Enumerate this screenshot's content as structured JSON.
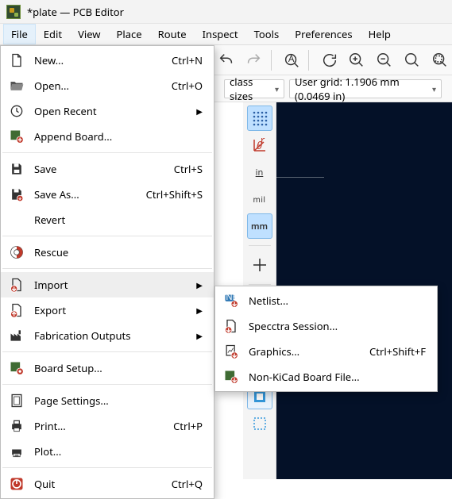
{
  "window": {
    "title": "*plate — PCB Editor"
  },
  "menubar": {
    "items": [
      "File",
      "Edit",
      "View",
      "Place",
      "Route",
      "Inspect",
      "Tools",
      "Preferences",
      "Help"
    ]
  },
  "toolbar": {
    "combo_class_sizes": "class sizes",
    "combo_grid": "User grid: 1.1906 mm (0.0469 in)"
  },
  "file_menu": {
    "new": {
      "label": "New...",
      "accel": "Ctrl+N"
    },
    "open": {
      "label": "Open...",
      "accel": "Ctrl+O"
    },
    "open_recent": {
      "label": "Open Recent"
    },
    "append_board": {
      "label": "Append Board..."
    },
    "save": {
      "label": "Save",
      "accel": "Ctrl+S"
    },
    "save_as": {
      "label": "Save As...",
      "accel": "Ctrl+Shift+S"
    },
    "revert": {
      "label": "Revert"
    },
    "rescue": {
      "label": "Rescue"
    },
    "import": {
      "label": "Import"
    },
    "export": {
      "label": "Export"
    },
    "fabrication": {
      "label": "Fabrication Outputs"
    },
    "board_setup": {
      "label": "Board Setup..."
    },
    "page_settings": {
      "label": "Page Settings..."
    },
    "print": {
      "label": "Print...",
      "accel": "Ctrl+P"
    },
    "plot": {
      "label": "Plot..."
    },
    "quit": {
      "label": "Quit",
      "accel": "Ctrl+Q"
    }
  },
  "import_menu": {
    "netlist": {
      "label": "Netlist..."
    },
    "specctra": {
      "label": "Specctra Session..."
    },
    "graphics": {
      "label": "Graphics...",
      "accel": "Ctrl+Shift+F"
    },
    "nonkicad": {
      "label": "Non-KiCad Board File..."
    }
  },
  "palette": {
    "mm": "mm",
    "mil": "mil",
    "in": "in"
  }
}
